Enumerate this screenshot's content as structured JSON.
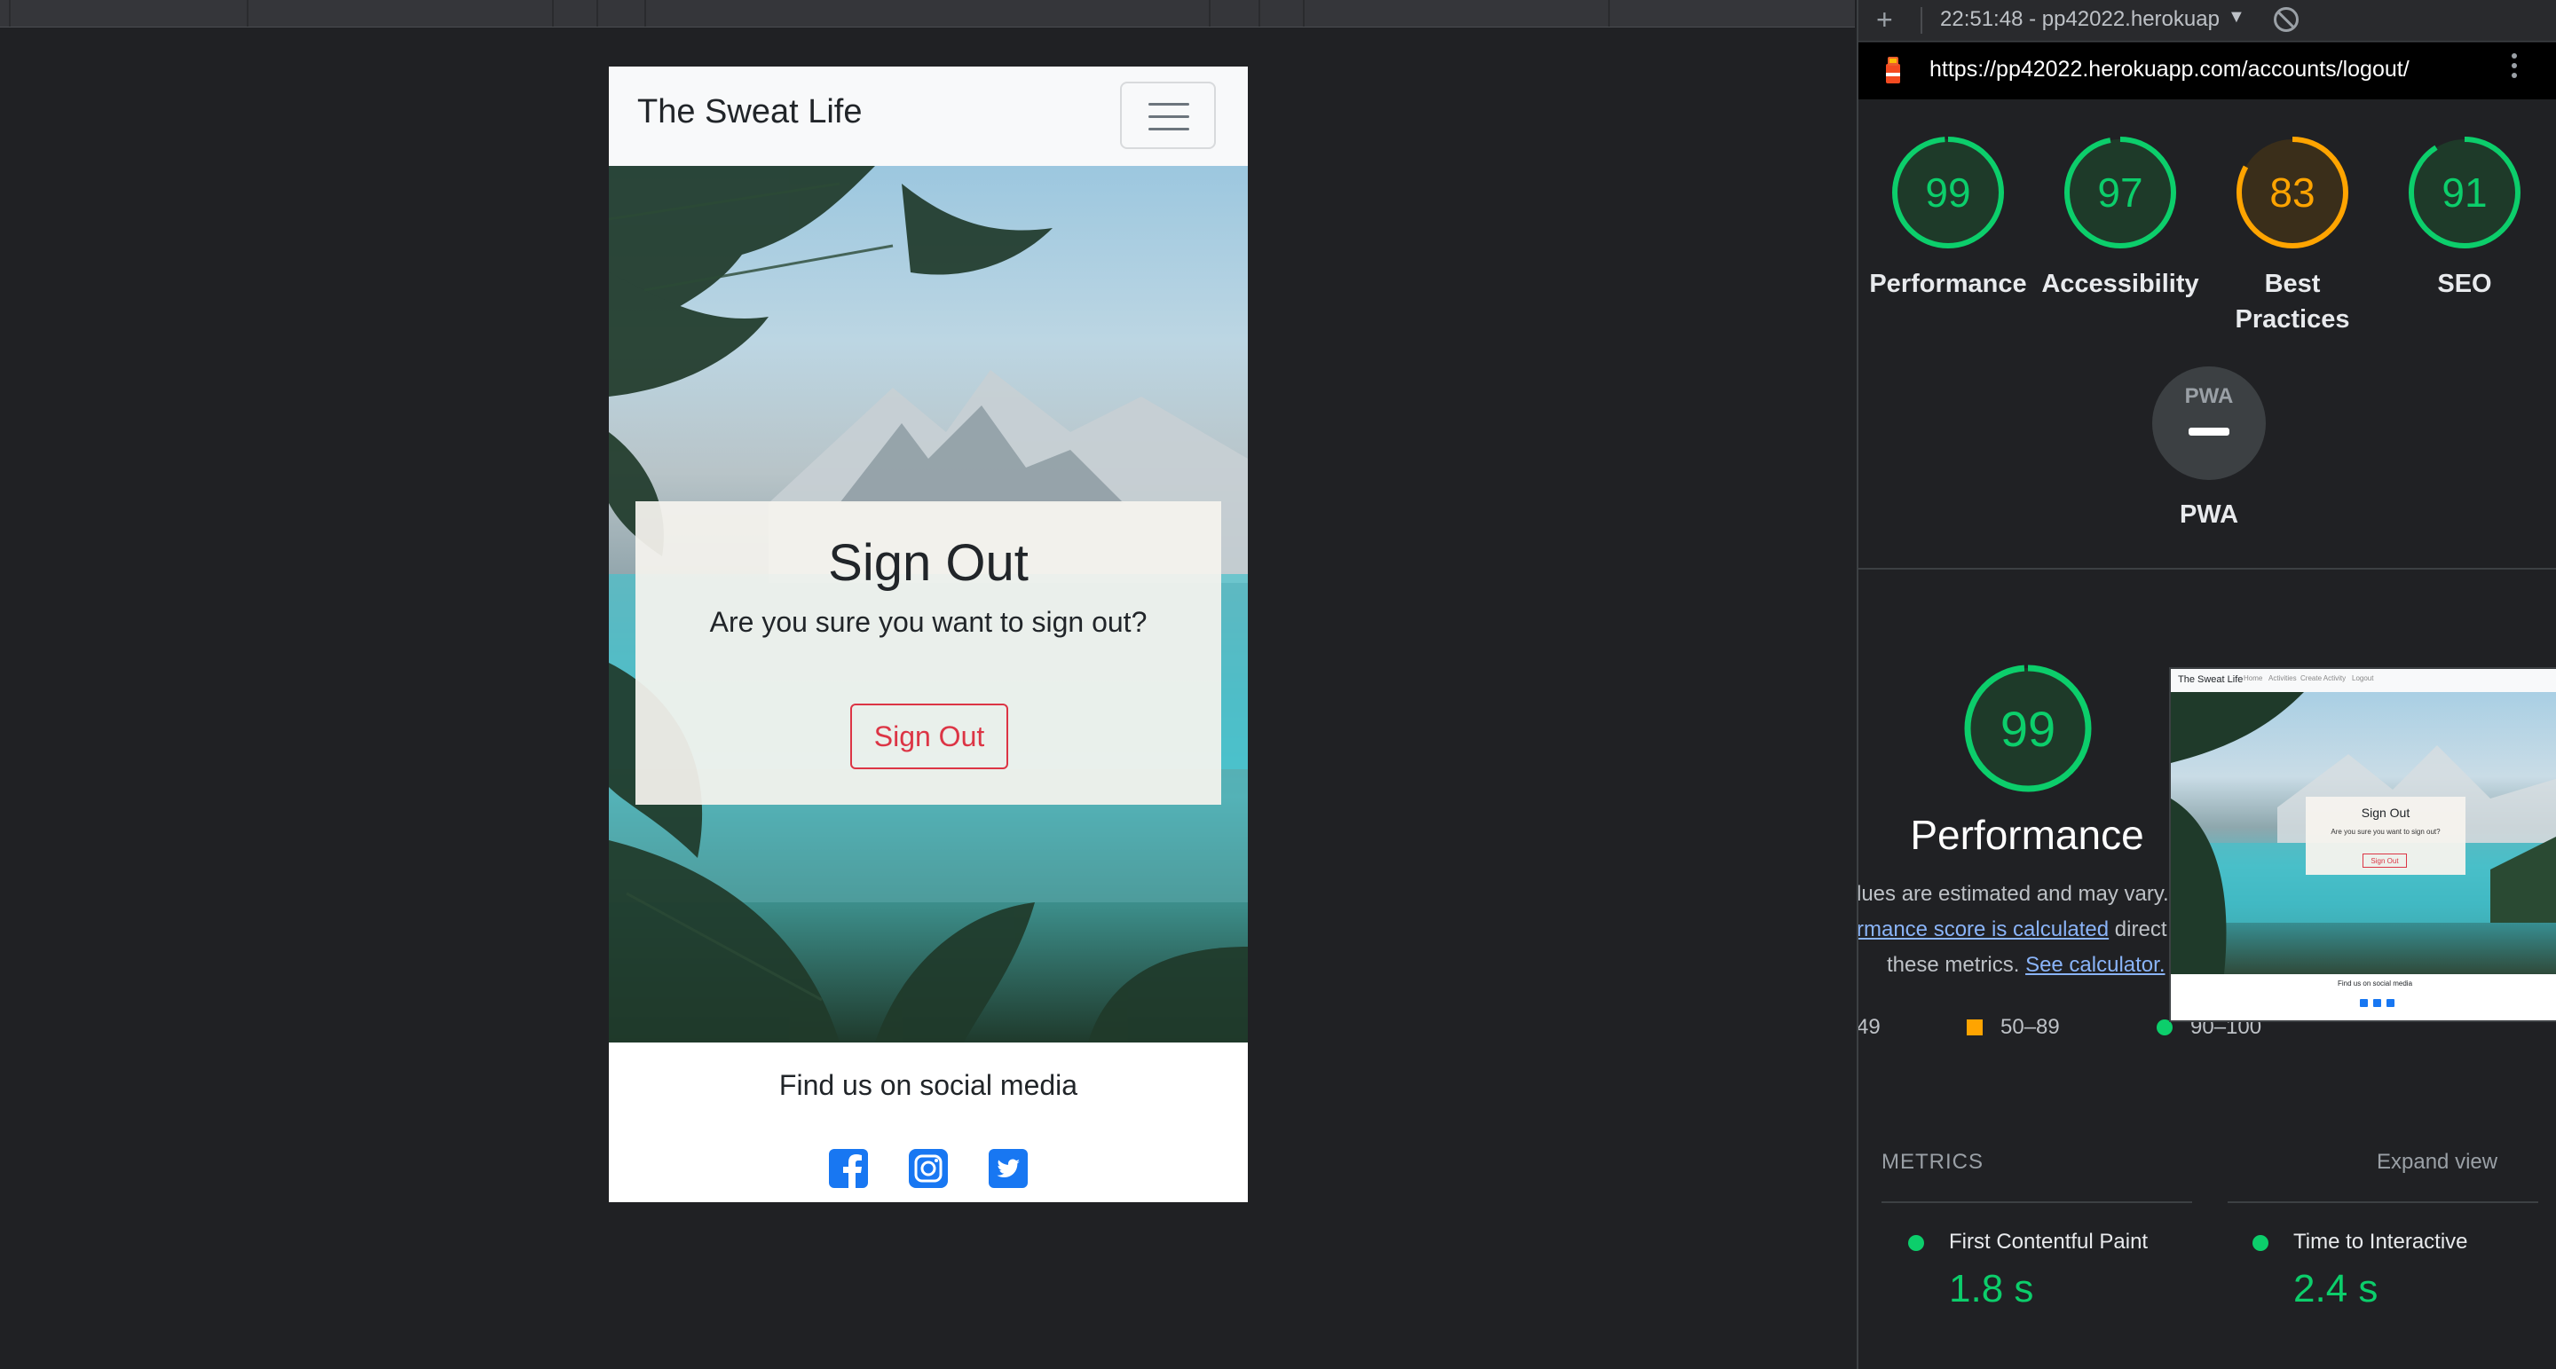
{
  "app": {
    "brand": "The Sweat Life",
    "signout_card": {
      "title": "Sign Out",
      "question": "Are you sure you want to sign out?",
      "button": "Sign Out"
    },
    "footer_title": "Find us on social media",
    "social": [
      "facebook-icon",
      "instagram-icon",
      "twitter-icon"
    ]
  },
  "devtools": {
    "run_label": "22:51:48 - pp42022.herokuap",
    "url": "https://pp42022.herokuapp.com/accounts/logout/",
    "scores": [
      {
        "label": "Performance",
        "value": "99",
        "color": "#0cce6b",
        "fraction": 0.99
      },
      {
        "label": "Accessibility",
        "value": "97",
        "color": "#0cce6b",
        "fraction": 0.97
      },
      {
        "label": "Best Practices",
        "value": "83",
        "color": "#ffa400",
        "fraction": 0.83
      },
      {
        "label": "SEO",
        "value": "91",
        "color": "#0cce6b",
        "fraction": 0.91
      }
    ],
    "pwa_label": "PWA",
    "pwa_badge": "PWA",
    "performance": {
      "score": "99",
      "title": "Performance",
      "line1": "lues are estimated and may vary.",
      "line2_link": "rmance score is calculated",
      "line2_rest": " direct",
      "line3_text": "these metrics.",
      "line3_link": "See calculator.",
      "legend": [
        "49",
        "50–89",
        "90–100"
      ]
    },
    "thumbnail": {
      "brand": "The Sweat Life",
      "nav": [
        "Home",
        "Activities",
        "Create Activity",
        "Logout"
      ],
      "title": "Sign Out",
      "question": "Are you sure you want to sign out?",
      "button": "Sign Out",
      "footer": "Find us on social media"
    },
    "metrics": {
      "heading": "METRICS",
      "expand": "Expand view",
      "items": [
        {
          "label": "First Contentful Paint",
          "value": "1.8 s"
        },
        {
          "label": "Time to Interactive",
          "value": "2.4 s"
        }
      ]
    },
    "colors": {
      "pass": "#0cce6b",
      "average": "#ffa400",
      "link": "#8ab4f8"
    }
  }
}
